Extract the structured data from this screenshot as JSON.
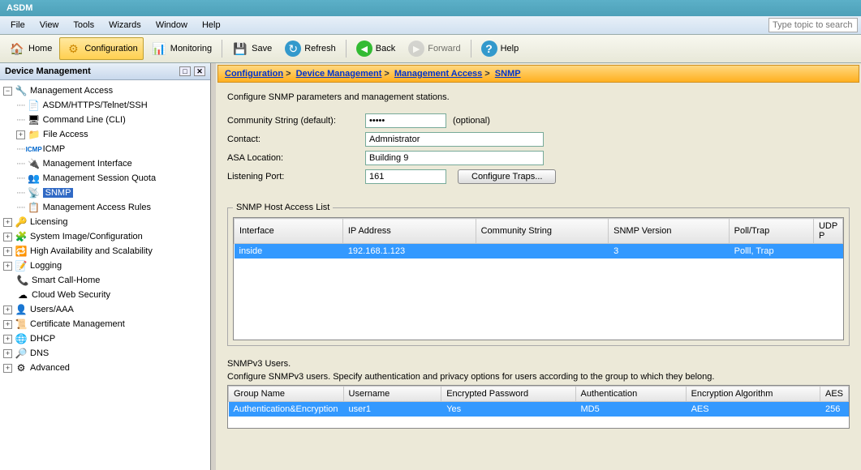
{
  "title": "ASDM",
  "menubar": [
    "File",
    "View",
    "Tools",
    "Wizards",
    "Window",
    "Help"
  ],
  "search_placeholder": "Type topic to search",
  "toolbar": {
    "home": "Home",
    "configuration": "Configuration",
    "monitoring": "Monitoring",
    "save": "Save",
    "refresh": "Refresh",
    "back": "Back",
    "forward": "Forward",
    "help": "Help"
  },
  "sidebar_title": "Device Management",
  "tree": {
    "root": "Management Access",
    "items": [
      "ASDM/HTTPS/Telnet/SSH",
      "Command Line (CLI)",
      "File Access",
      "ICMP",
      "Management Interface",
      "Management Session Quota",
      "SNMP",
      "Management Access Rules"
    ],
    "top_level": [
      "Licensing",
      "System Image/Configuration",
      "High Availability and Scalability",
      "Logging",
      "Smart Call-Home",
      "Cloud Web Security",
      "Users/AAA",
      "Certificate Management",
      "DHCP",
      "DNS",
      "Advanced"
    ]
  },
  "breadcrumb": [
    "Configuration",
    "Device Management",
    "Management Access",
    "SNMP"
  ],
  "form": {
    "description": "Configure SNMP parameters and management stations.",
    "community_label": "Community String (default):",
    "community_value": "•••••",
    "optional": "(optional)",
    "contact_label": "Contact:",
    "contact_value": "Admnistrator",
    "location_label": "ASA Location:",
    "location_value": "Building 9",
    "port_label": "Listening Port:",
    "port_value": "161",
    "traps_button": "Configure Traps..."
  },
  "hostlist": {
    "legend": "SNMP Host Access List",
    "headers": [
      "Interface",
      "IP Address",
      "Community String",
      "SNMP Version",
      "Poll/Trap",
      "UDP P"
    ],
    "row": [
      "inside",
      "192.168.1.123",
      "",
      "3",
      "Polll, Trap",
      ""
    ]
  },
  "users": {
    "title": "SNMPv3 Users.",
    "desc": "Configure SNMPv3 users. Specify authentication and privacy options for users according to the group to which they belong.",
    "headers": [
      "Group Name",
      "Username",
      "Encrypted Password",
      "Authentication",
      "Encryption Algorithm",
      "AES"
    ],
    "row": [
      "Authentication&Encryption",
      "user1",
      "Yes",
      "MD5",
      "AES",
      "256"
    ]
  }
}
